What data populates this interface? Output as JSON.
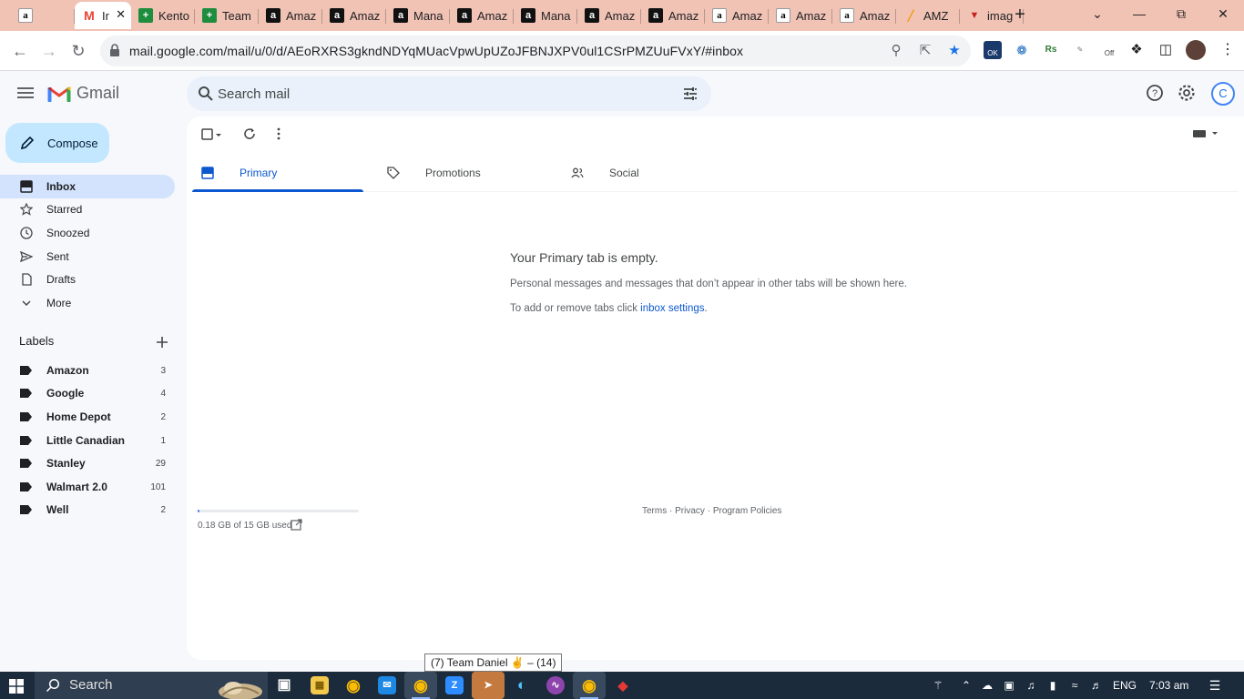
{
  "browser": {
    "tabs": [
      {
        "title": "",
        "icon": "amazon-icon"
      },
      {
        "title": "Ir",
        "icon": "gmail-icon",
        "active": true
      },
      {
        "title": "Kento",
        "icon": "sheets-icon"
      },
      {
        "title": "Team",
        "icon": "sheets-icon"
      },
      {
        "title": "Amaz",
        "icon": "amazon-dark-icon"
      },
      {
        "title": "Amaz",
        "icon": "amazon-dark-icon"
      },
      {
        "title": "Mana",
        "icon": "amazon-dark-icon"
      },
      {
        "title": "Amaz",
        "icon": "amazon-dark-icon"
      },
      {
        "title": "Mana",
        "icon": "amazon-dark-icon"
      },
      {
        "title": "Amaz",
        "icon": "amazon-dark-icon"
      },
      {
        "title": "Amaz",
        "icon": "amazon-dark-icon"
      },
      {
        "title": "Amaz",
        "icon": "amazon-icon"
      },
      {
        "title": "Amaz",
        "icon": "amazon-icon"
      },
      {
        "title": "Amaz",
        "icon": "amazon-icon"
      },
      {
        "title": "AMZ",
        "icon": "amz-icon"
      },
      {
        "title": "imag",
        "icon": "image-icon"
      }
    ],
    "url": "mail.google.com/mail/u/0/d/AEoRXRS3gkndNDYqMUacVpwUpUZoJFBNJXPV0ul1CSrPMZUuFVxY/#inbox",
    "ext_badge_ok": "OK",
    "ext_badge_off": "Off"
  },
  "gmail": {
    "brand": "Gmail",
    "search_placeholder": "Search mail",
    "account_initial": "C",
    "compose_label": "Compose",
    "nav": [
      {
        "label": "Inbox",
        "icon": "inbox-icon",
        "active": true
      },
      {
        "label": "Starred",
        "icon": "star-icon"
      },
      {
        "label": "Snoozed",
        "icon": "clock-icon"
      },
      {
        "label": "Sent",
        "icon": "send-icon"
      },
      {
        "label": "Drafts",
        "icon": "draft-icon"
      },
      {
        "label": "More",
        "icon": "chevron-down-icon"
      }
    ],
    "labels_title": "Labels",
    "labels": [
      {
        "name": "Amazon",
        "count": "3"
      },
      {
        "name": "Google",
        "count": "4"
      },
      {
        "name": "Home Depot",
        "count": "2"
      },
      {
        "name": "Little Canadian",
        "count": "1"
      },
      {
        "name": "Stanley",
        "count": "29"
      },
      {
        "name": "Walmart 2.0",
        "count": "101"
      },
      {
        "name": "Well",
        "count": "2"
      }
    ],
    "category_tabs": [
      {
        "label": "Primary",
        "icon": "inbox-icon",
        "active": true
      },
      {
        "label": "Promotions",
        "icon": "tag-icon"
      },
      {
        "label": "Social",
        "icon": "people-icon"
      }
    ],
    "empty": {
      "title": "Your Primary tab is empty.",
      "description": "Personal messages and messages that don’t appear in other tabs will be shown here.",
      "hint_prefix": "To add or remove tabs click ",
      "hint_link": "inbox settings",
      "hint_suffix": "."
    },
    "storage": {
      "text": "0.18 GB of 15 GB used",
      "used_fraction": 0.012
    },
    "footer": {
      "terms": "Terms",
      "privacy": "Privacy",
      "policies": "Program Policies",
      "separator": " · "
    }
  },
  "tooltip": "(7) Team Daniel ✌️ – (14)",
  "taskbar": {
    "search_label": "Search",
    "language": "ENG",
    "time": "7:03 am"
  },
  "colors": {
    "tab_strip": "#f1c3b4",
    "accent": "#0b57d0",
    "compose": "#c2e7ff",
    "nav_active": "#d3e3fd",
    "taskbar": "#1c2b3c"
  }
}
